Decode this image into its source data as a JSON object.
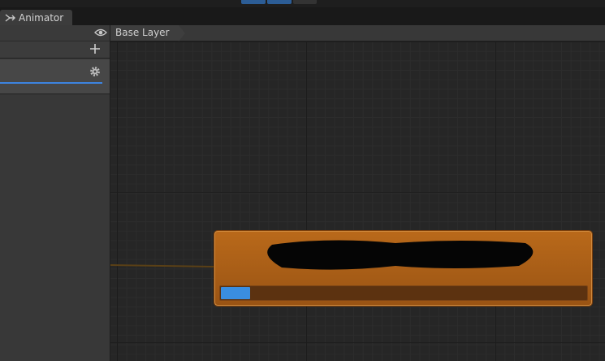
{
  "window": {
    "tab_label": "Animator",
    "tab_icon": "animator-icon"
  },
  "toolbar": {
    "button_colors": [
      "#2c5d96",
      "#2c5d96",
      "#333333"
    ]
  },
  "left_panel": {
    "visibility_icon": "eye-icon",
    "add_icon": "plus-icon",
    "settings_icon": "gear-icon",
    "weight_color": "#3d84e0"
  },
  "breadcrumb": {
    "label": "Base Layer"
  },
  "state_node": {
    "name": "",
    "name_redacted": true,
    "color": "#b9691a",
    "progress": 0.08
  }
}
